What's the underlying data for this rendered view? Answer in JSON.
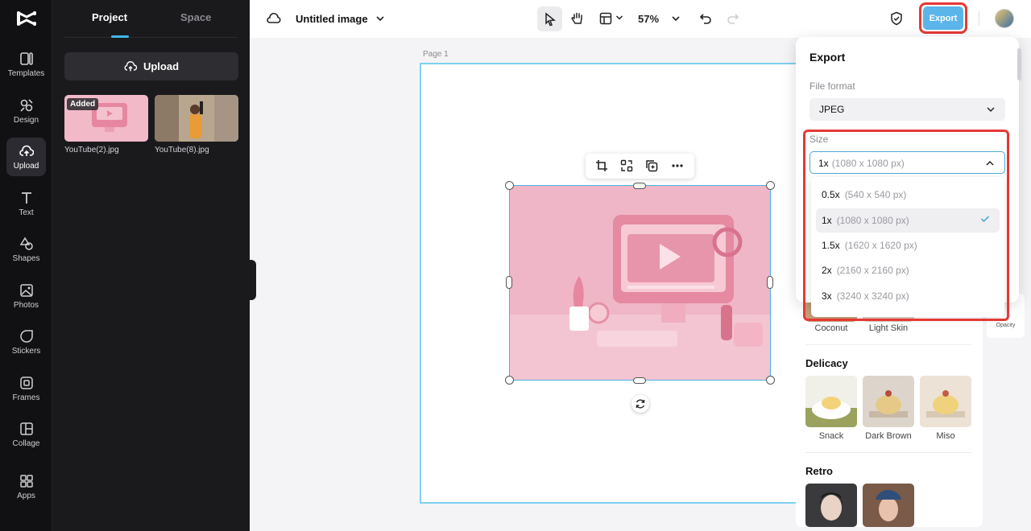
{
  "rail": {
    "items": [
      {
        "label": "Templates",
        "icon": "templates-icon"
      },
      {
        "label": "Design",
        "icon": "design-icon"
      },
      {
        "label": "Upload",
        "icon": "upload-cloud-icon"
      },
      {
        "label": "Text",
        "icon": "text-icon"
      },
      {
        "label": "Shapes",
        "icon": "shapes-icon"
      },
      {
        "label": "Photos",
        "icon": "photos-icon"
      },
      {
        "label": "Stickers",
        "icon": "stickers-icon"
      },
      {
        "label": "Frames",
        "icon": "frames-icon"
      },
      {
        "label": "Collage",
        "icon": "collage-icon"
      },
      {
        "label": "Apps",
        "icon": "apps-icon"
      }
    ],
    "active": "Upload"
  },
  "library": {
    "tabs": [
      "Project",
      "Space"
    ],
    "active_tab": "Project",
    "upload_label": "Upload",
    "files": [
      {
        "name": "YouTube(2).jpg",
        "badge": "Added"
      },
      {
        "name": "YouTube(8).jpg",
        "badge": ""
      }
    ]
  },
  "toolbar": {
    "title": "Untitled image",
    "zoom": "57%",
    "export_label": "Export"
  },
  "canvas": {
    "page_label": "Page 1"
  },
  "export_panel": {
    "title": "Export",
    "file_format_label": "File format",
    "file_format_value": "JPEG",
    "size_label": "Size",
    "size_value_scale": "1x",
    "size_value_dims": "(1080 x 1080 px)",
    "size_options": [
      {
        "scale": "0.5x",
        "dims": "(540 x 540 px)",
        "selected": false
      },
      {
        "scale": "1x",
        "dims": "(1080 x 1080 px)",
        "selected": true
      },
      {
        "scale": "1.5x",
        "dims": "(1620 x 1620 px)",
        "selected": false
      },
      {
        "scale": "2x",
        "dims": "(2160 x 2160 px)",
        "selected": false
      },
      {
        "scale": "3x",
        "dims": "(3240 x 3240 px)",
        "selected": false
      }
    ]
  },
  "filters": {
    "row0_captions": [
      "Coconut",
      "Light Skin"
    ],
    "sections": [
      {
        "title": "Delicacy",
        "items": [
          "Snack",
          "Dark Brown",
          "Miso"
        ]
      },
      {
        "title": "Retro",
        "items": []
      }
    ],
    "opacity_label": "Opacity"
  },
  "colors": {
    "accent": "#5bb5ea",
    "highlight_red": "#e53935",
    "dark_bg": "#111113"
  }
}
